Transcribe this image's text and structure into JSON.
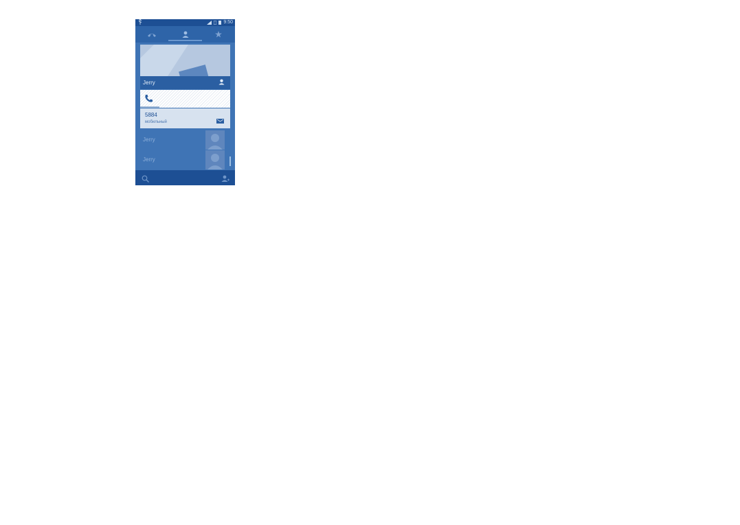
{
  "status_bar": {
    "time": "9:50",
    "icons": [
      "usb-icon",
      "signal-icon",
      "sim-icon",
      "battery-icon"
    ]
  },
  "tabs": [
    {
      "name": "call-log",
      "icon": "call-log-icon"
    },
    {
      "name": "contacts",
      "icon": "person-icon",
      "selected": true
    },
    {
      "name": "favorites",
      "icon": "star-icon"
    }
  ],
  "contact_card": {
    "name": "Jerry",
    "phone_number": "5884",
    "phone_type": "мобильный"
  },
  "contact_list": {
    "items": [
      {
        "name": "Jerry"
      },
      {
        "name": "Jerry"
      }
    ]
  },
  "bottom_bar": {
    "icons": [
      "search-icon",
      "add-contact-icon"
    ]
  },
  "colors": {
    "background": "#3f74b5",
    "dark_bar": "#1d4f94",
    "accent": "#2b5fa2"
  }
}
